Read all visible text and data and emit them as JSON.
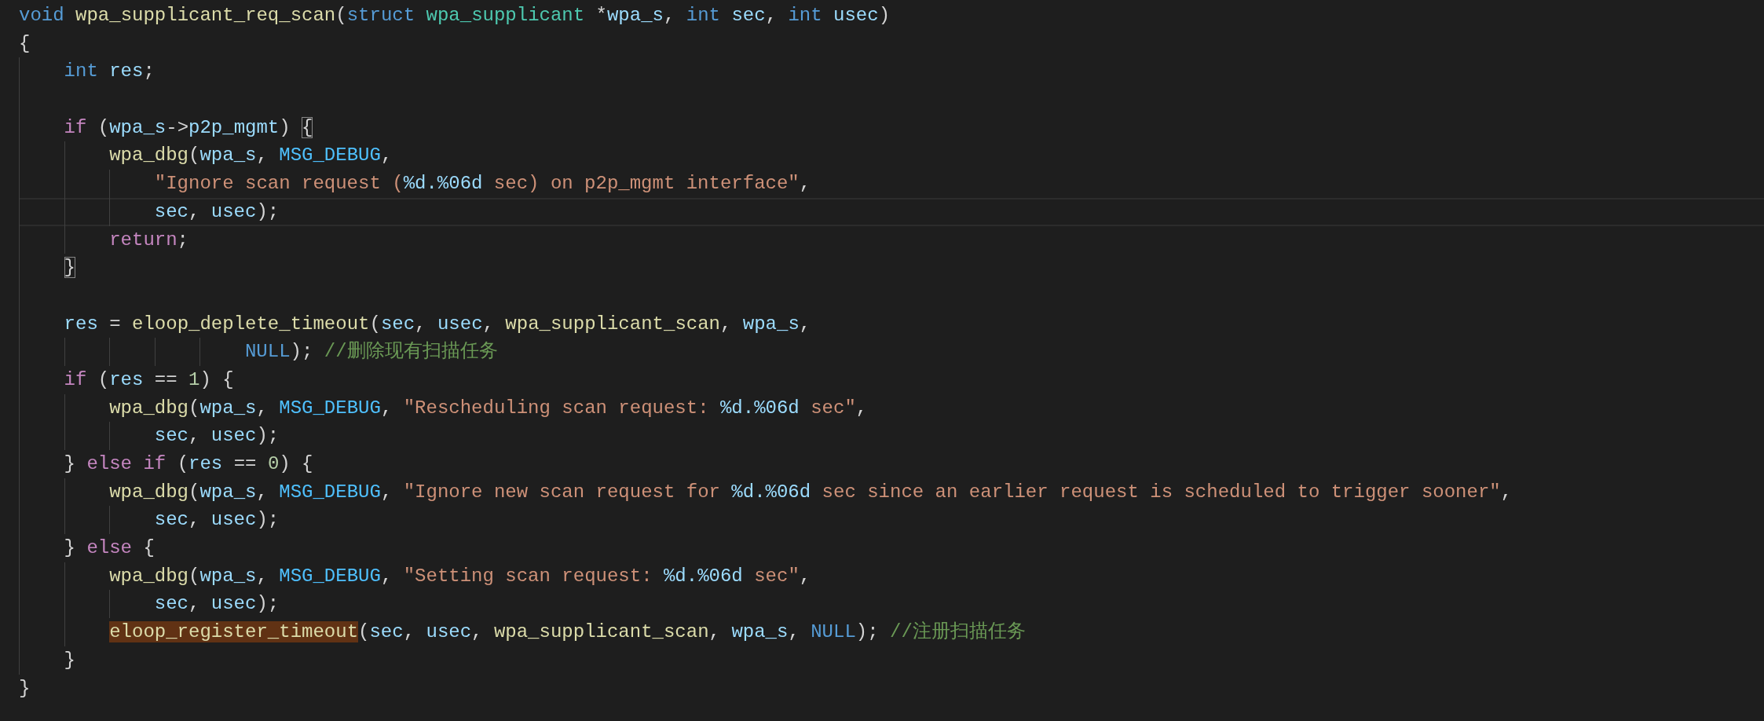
{
  "editor": {
    "lines": [
      {
        "current": false,
        "tokens": [
          {
            "kind": "kw",
            "text": "void "
          },
          {
            "kind": "fn",
            "text": "wpa_supplicant_req_scan"
          },
          {
            "kind": "punc",
            "text": "("
          },
          {
            "kind": "kw",
            "text": "struct "
          },
          {
            "kind": "type",
            "text": "wpa_supplicant"
          },
          {
            "kind": "punc",
            "text": " *"
          },
          {
            "kind": "var",
            "text": "wpa_s"
          },
          {
            "kind": "punc",
            "text": ", "
          },
          {
            "kind": "kw",
            "text": "int "
          },
          {
            "kind": "var",
            "text": "sec"
          },
          {
            "kind": "punc",
            "text": ", "
          },
          {
            "kind": "kw",
            "text": "int "
          },
          {
            "kind": "var",
            "text": "usec"
          },
          {
            "kind": "punc",
            "text": ")"
          }
        ]
      },
      {
        "current": false,
        "tokens": [
          {
            "kind": "punc",
            "text": "{"
          }
        ]
      },
      {
        "current": false,
        "tokens": [
          {
            "kind": "kw",
            "text": "    int "
          },
          {
            "kind": "var",
            "text": "res"
          },
          {
            "kind": "punc",
            "text": ";"
          }
        ]
      },
      {
        "current": false
      },
      {
        "current": false,
        "tokens": [
          {
            "kind": "ctl",
            "text": "    if"
          },
          {
            "kind": "punc",
            "text": " ("
          },
          {
            "kind": "var",
            "text": "wpa_s"
          },
          {
            "kind": "punc",
            "text": "->"
          },
          {
            "kind": "var",
            "text": "p2p_mgmt"
          },
          {
            "kind": "punc",
            "text": ") "
          },
          {
            "kind": "match",
            "text": "{"
          }
        ]
      },
      {
        "current": false,
        "tokens": [
          {
            "kind": "fn",
            "text": "        wpa_dbg"
          },
          {
            "kind": "punc",
            "text": "("
          },
          {
            "kind": "var",
            "text": "wpa_s"
          },
          {
            "kind": "punc",
            "text": ", "
          },
          {
            "kind": "macro",
            "text": "MSG_DEBUG"
          },
          {
            "kind": "punc",
            "text": ","
          }
        ]
      },
      {
        "current": false,
        "tokens": [
          {
            "kind": "str",
            "text": "            \"Ignore scan request ("
          },
          {
            "kind": "fmt",
            "text": "%d.%06d"
          },
          {
            "kind": "str",
            "text": " sec) on p2p_mgmt interface\""
          },
          {
            "kind": "punc",
            "text": ","
          }
        ]
      },
      {
        "current": true,
        "tokens": [
          {
            "kind": "var",
            "text": "            sec"
          },
          {
            "kind": "punc",
            "text": ", "
          },
          {
            "kind": "var",
            "text": "usec"
          },
          {
            "kind": "punc",
            "text": ");"
          }
        ]
      },
      {
        "current": false,
        "tokens": [
          {
            "kind": "ctl",
            "text": "        return"
          },
          {
            "kind": "punc",
            "text": ";"
          }
        ]
      },
      {
        "current": false,
        "tokens": [
          {
            "kind": "match",
            "text": "    }"
          }
        ]
      },
      {
        "current": false
      },
      {
        "current": false,
        "tokens": [
          {
            "kind": "var",
            "text": "    res"
          },
          {
            "kind": "punc",
            "text": " = "
          },
          {
            "kind": "fn",
            "text": "eloop_deplete_timeout"
          },
          {
            "kind": "punc",
            "text": "("
          },
          {
            "kind": "var",
            "text": "sec"
          },
          {
            "kind": "punc",
            "text": ", "
          },
          {
            "kind": "var",
            "text": "usec"
          },
          {
            "kind": "punc",
            "text": ", "
          },
          {
            "kind": "fn",
            "text": "wpa_supplicant_scan"
          },
          {
            "kind": "punc",
            "text": ", "
          },
          {
            "kind": "var",
            "text": "wpa_s"
          },
          {
            "kind": "punc",
            "text": ","
          }
        ]
      },
      {
        "current": false,
        "tokens": [
          {
            "kind": "kw",
            "text": "                    NULL"
          },
          {
            "kind": "punc",
            "text": "); "
          },
          {
            "kind": "cmt",
            "text": "//删除现有扫描任务"
          }
        ]
      },
      {
        "current": false,
        "tokens": [
          {
            "kind": "ctl",
            "text": "    if"
          },
          {
            "kind": "punc",
            "text": " ("
          },
          {
            "kind": "var",
            "text": "res"
          },
          {
            "kind": "punc",
            "text": " == "
          },
          {
            "kind": "num",
            "text": "1"
          },
          {
            "kind": "punc",
            "text": ") {"
          }
        ]
      },
      {
        "current": false,
        "tokens": [
          {
            "kind": "fn",
            "text": "        wpa_dbg"
          },
          {
            "kind": "punc",
            "text": "("
          },
          {
            "kind": "var",
            "text": "wpa_s"
          },
          {
            "kind": "punc",
            "text": ", "
          },
          {
            "kind": "macro",
            "text": "MSG_DEBUG"
          },
          {
            "kind": "punc",
            "text": ", "
          },
          {
            "kind": "str",
            "text": "\"Rescheduling scan request: "
          },
          {
            "kind": "fmt",
            "text": "%d.%06d"
          },
          {
            "kind": "str",
            "text": " sec\""
          },
          {
            "kind": "punc",
            "text": ","
          }
        ]
      },
      {
        "current": false,
        "tokens": [
          {
            "kind": "var",
            "text": "            sec"
          },
          {
            "kind": "punc",
            "text": ", "
          },
          {
            "kind": "var",
            "text": "usec"
          },
          {
            "kind": "punc",
            "text": ");"
          }
        ]
      },
      {
        "current": false,
        "tokens": [
          {
            "kind": "punc",
            "text": "    } "
          },
          {
            "kind": "ctl",
            "text": "else if"
          },
          {
            "kind": "punc",
            "text": " ("
          },
          {
            "kind": "var",
            "text": "res"
          },
          {
            "kind": "punc",
            "text": " == "
          },
          {
            "kind": "num",
            "text": "0"
          },
          {
            "kind": "punc",
            "text": ") {"
          }
        ]
      },
      {
        "current": false,
        "tokens": [
          {
            "kind": "fn",
            "text": "        wpa_dbg"
          },
          {
            "kind": "punc",
            "text": "("
          },
          {
            "kind": "var",
            "text": "wpa_s"
          },
          {
            "kind": "punc",
            "text": ", "
          },
          {
            "kind": "macro",
            "text": "MSG_DEBUG"
          },
          {
            "kind": "punc",
            "text": ", "
          },
          {
            "kind": "str",
            "text": "\"Ignore new scan request for "
          },
          {
            "kind": "fmt",
            "text": "%d.%06d"
          },
          {
            "kind": "str",
            "text": " sec since an earlier request is scheduled to trigger sooner\""
          },
          {
            "kind": "punc",
            "text": ","
          }
        ]
      },
      {
        "current": false,
        "tokens": [
          {
            "kind": "var",
            "text": "            sec"
          },
          {
            "kind": "punc",
            "text": ", "
          },
          {
            "kind": "var",
            "text": "usec"
          },
          {
            "kind": "punc",
            "text": ");"
          }
        ]
      },
      {
        "current": false,
        "tokens": [
          {
            "kind": "punc",
            "text": "    } "
          },
          {
            "kind": "ctl",
            "text": "else"
          },
          {
            "kind": "punc",
            "text": " {"
          }
        ]
      },
      {
        "current": false,
        "tokens": [
          {
            "kind": "fn",
            "text": "        wpa_dbg"
          },
          {
            "kind": "punc",
            "text": "("
          },
          {
            "kind": "var",
            "text": "wpa_s"
          },
          {
            "kind": "punc",
            "text": ", "
          },
          {
            "kind": "macro",
            "text": "MSG_DEBUG"
          },
          {
            "kind": "punc",
            "text": ", "
          },
          {
            "kind": "str",
            "text": "\"Setting scan request: "
          },
          {
            "kind": "fmt",
            "text": "%d.%06d"
          },
          {
            "kind": "str",
            "text": " sec\""
          },
          {
            "kind": "punc",
            "text": ","
          }
        ]
      },
      {
        "current": false,
        "tokens": [
          {
            "kind": "var",
            "text": "            sec"
          },
          {
            "kind": "punc",
            "text": ", "
          },
          {
            "kind": "var",
            "text": "usec"
          },
          {
            "kind": "punc",
            "text": ");"
          }
        ]
      },
      {
        "current": false,
        "tokens": [
          {
            "kind": "hl",
            "text": "        eloop_register_timeout"
          },
          {
            "kind": "punc",
            "text": "("
          },
          {
            "kind": "var",
            "text": "sec"
          },
          {
            "kind": "punc",
            "text": ", "
          },
          {
            "kind": "var",
            "text": "usec"
          },
          {
            "kind": "punc",
            "text": ", "
          },
          {
            "kind": "fn",
            "text": "wpa_supplicant_scan"
          },
          {
            "kind": "punc",
            "text": ", "
          },
          {
            "kind": "var",
            "text": "wpa_s"
          },
          {
            "kind": "punc",
            "text": ", "
          },
          {
            "kind": "kw",
            "text": "NULL"
          },
          {
            "kind": "punc",
            "text": "); "
          },
          {
            "kind": "cmt",
            "text": "//注册扫描任务"
          }
        ]
      },
      {
        "current": false,
        "tokens": [
          {
            "kind": "punc",
            "text": "    }"
          }
        ]
      },
      {
        "current": false,
        "tokens": [
          {
            "kind": "punc",
            "text": "}"
          }
        ]
      }
    ]
  }
}
